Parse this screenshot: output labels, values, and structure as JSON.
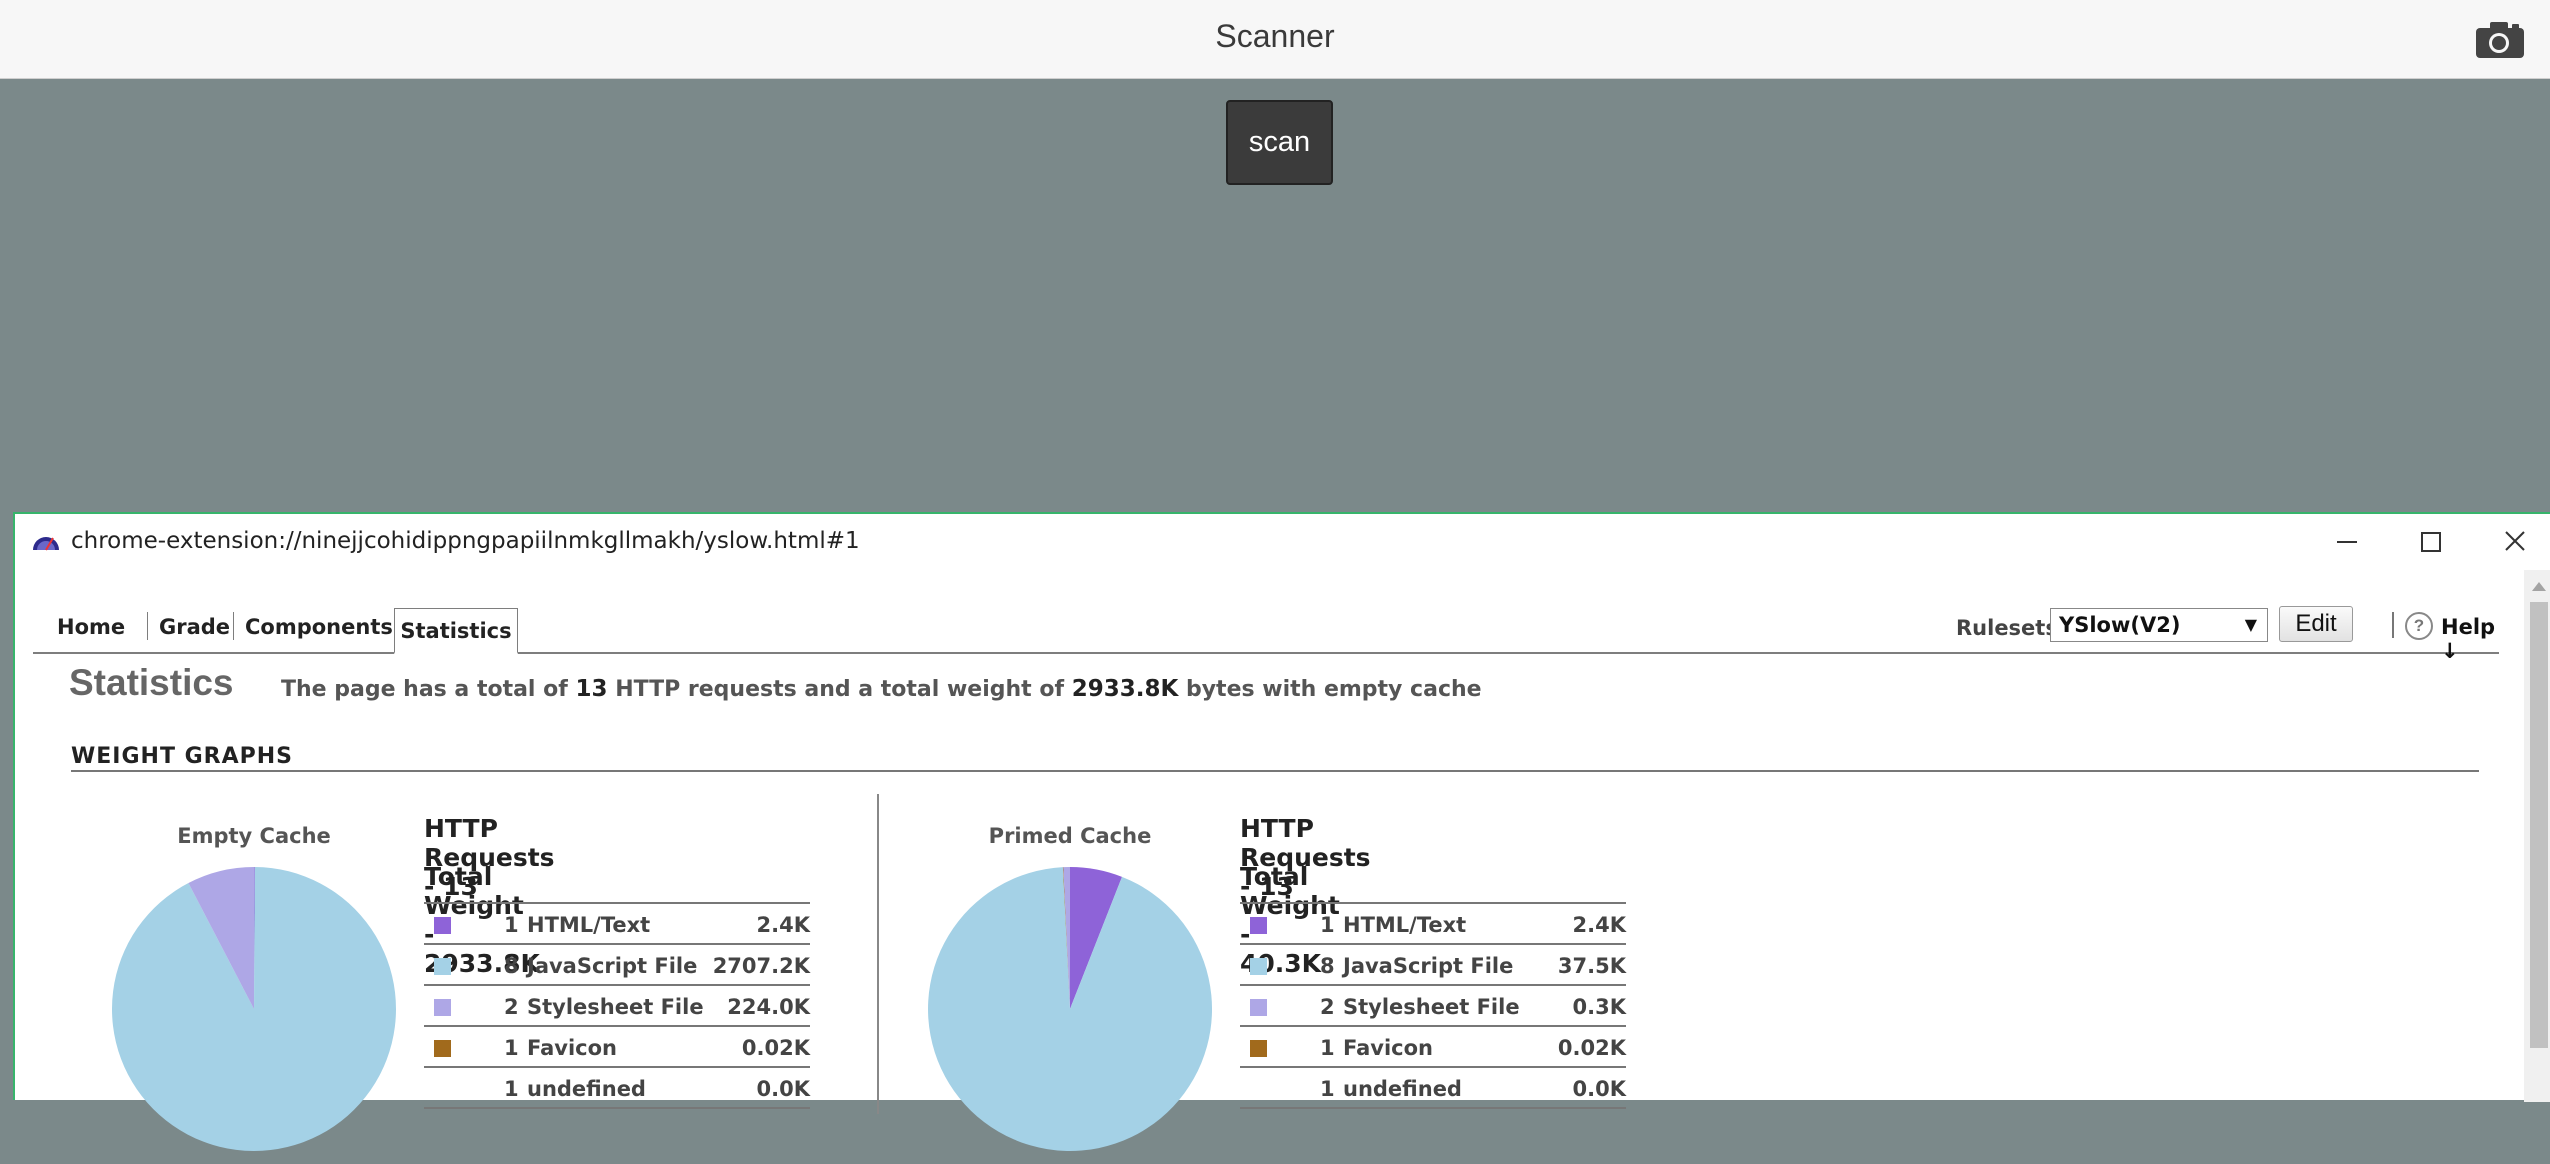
{
  "app": {
    "title": "Scanner",
    "camera_icon": "camera-icon"
  },
  "scan_button": {
    "label": "scan"
  },
  "window": {
    "url": "chrome-extension://ninejjcohidippngpapiilnmkgllmakh/yslow.html#1",
    "favicon": "yslow-gauge-icon"
  },
  "tabs": [
    {
      "label": "Home"
    },
    {
      "label": "Grade"
    },
    {
      "label": "Components"
    },
    {
      "label": "Statistics",
      "active": true
    }
  ],
  "rulesets": {
    "label": "Rulesets",
    "selected": "YSlow(V2)",
    "edit_label": "Edit",
    "help_label": "Help ↓"
  },
  "statistics": {
    "title": "Statistics",
    "summary": {
      "prefix": "The page has a total of",
      "requests": "13",
      "middle": "HTTP requests and a total weight of",
      "weight": "2933.8K",
      "suffix": "bytes with empty cache"
    },
    "weight_graphs_heading": "WEIGHT GRAPHS"
  },
  "colors": {
    "html": "#8e63d8",
    "javascript": "#a4d1e6",
    "stylesheet": "#aea7e6",
    "favicon": "#a16a1c"
  },
  "empty_cache": {
    "label": "Empty Cache",
    "http_requests": "HTTP Requests - 13",
    "total_weight": "Total Weight - 2933.8K",
    "rows": [
      {
        "count": "1",
        "type": "HTML/Text",
        "size": "2.4K",
        "color": "#8e63d8"
      },
      {
        "count": "8",
        "type": "JavaScript File",
        "size": "2707.2K",
        "color": "#a4d1e6"
      },
      {
        "count": "2",
        "type": "Stylesheet File",
        "size": "224.0K",
        "color": "#aea7e6"
      },
      {
        "count": "1",
        "type": "Favicon",
        "size": "0.02K",
        "color": "#a16a1c"
      },
      {
        "count": "1",
        "type": "undefined",
        "size": "0.0K",
        "color": ""
      }
    ],
    "pie_kb": [
      2.4,
      2707.2,
      224.0,
      0.02
    ]
  },
  "primed_cache": {
    "label": "Primed Cache",
    "http_requests": "HTTP Requests - 13",
    "total_weight": "Total Weight - 40.3K",
    "rows": [
      {
        "count": "1",
        "type": "HTML/Text",
        "size": "2.4K",
        "color": "#8e63d8"
      },
      {
        "count": "8",
        "type": "JavaScript File",
        "size": "37.5K",
        "color": "#a4d1e6"
      },
      {
        "count": "2",
        "type": "Stylesheet File",
        "size": "0.3K",
        "color": "#aea7e6"
      },
      {
        "count": "1",
        "type": "Favicon",
        "size": "0.02K",
        "color": "#a16a1c"
      },
      {
        "count": "1",
        "type": "undefined",
        "size": "0.0K",
        "color": ""
      }
    ],
    "pie_kb": [
      2.4,
      37.5,
      0.3,
      0.02
    ]
  }
}
